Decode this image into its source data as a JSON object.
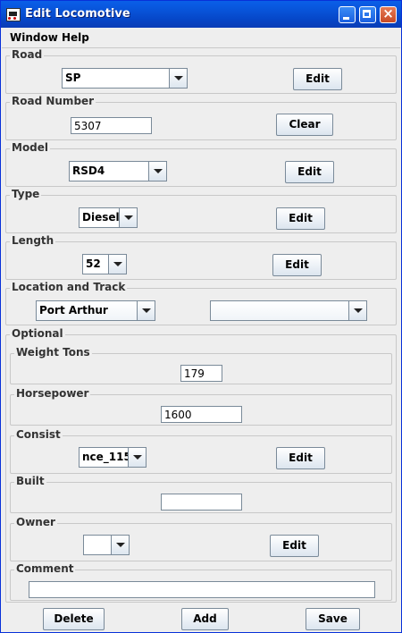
{
  "window": {
    "title": "Edit Locomotive"
  },
  "menu": {
    "items": [
      "Window",
      "Help"
    ]
  },
  "road": {
    "label": "Road",
    "value": "SP",
    "edit": "Edit"
  },
  "road_number": {
    "label": "Road Number",
    "value": "5307",
    "clear": "Clear"
  },
  "model": {
    "label": "Model",
    "value": "RSD4",
    "edit": "Edit"
  },
  "type": {
    "label": "Type",
    "value": "Diesel",
    "edit": "Edit"
  },
  "length": {
    "label": "Length",
    "value": "52",
    "edit": "Edit"
  },
  "location": {
    "label": "Location and Track",
    "location_value": "Port Arthur",
    "track_value": ""
  },
  "optional": {
    "label": "Optional",
    "weight": {
      "label": "Weight Tons",
      "value": "179"
    },
    "horsepower": {
      "label": "Horsepower",
      "value": "1600"
    },
    "consist": {
      "label": "Consist",
      "value": "nce_115",
      "edit": "Edit"
    },
    "built": {
      "label": "Built",
      "value": ""
    },
    "owner": {
      "label": "Owner",
      "value": "",
      "edit": "Edit"
    },
    "comment": {
      "label": "Comment",
      "value": ""
    }
  },
  "actions": {
    "delete": "Delete",
    "add": "Add",
    "save": "Save"
  }
}
